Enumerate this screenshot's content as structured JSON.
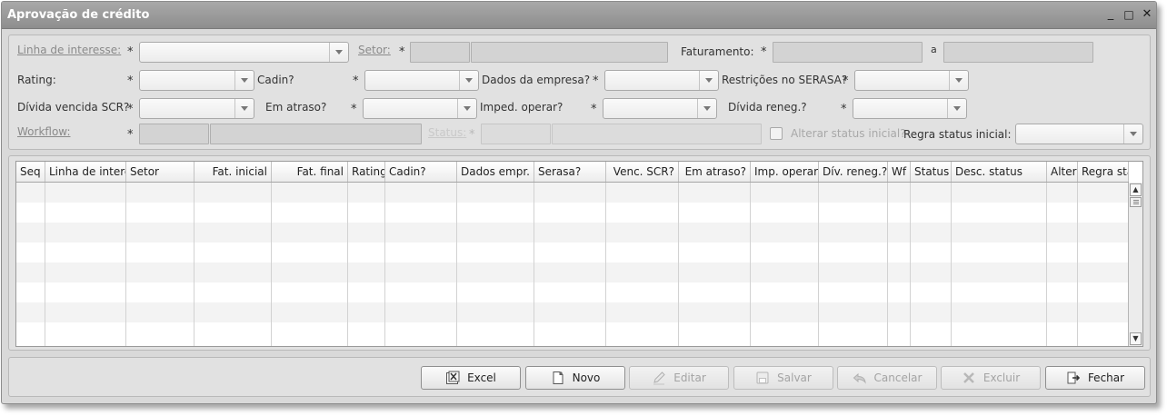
{
  "window": {
    "title": "Aprovação de crédito",
    "controls": {
      "minimize": "_",
      "maximize": "□",
      "close": "✕"
    }
  },
  "filters": {
    "required_mark": "*",
    "linha_interesse": {
      "label": "Linha de interesse:",
      "value": ""
    },
    "setor": {
      "label": "Setor:",
      "code": "",
      "description": ""
    },
    "faturamento": {
      "label": "Faturamento:",
      "from": "",
      "range_sep": "a",
      "to": ""
    },
    "rating": {
      "label": "Rating:",
      "value": ""
    },
    "cadin": {
      "label": "Cadin?",
      "value": ""
    },
    "dados_empresa": {
      "label": "Dados da empresa?",
      "value": ""
    },
    "restricoes_serasa": {
      "label": "Restrições no SERASA?",
      "value": ""
    },
    "divida_vencida_scr": {
      "label": "Dívida vencida SCR?",
      "value": ""
    },
    "em_atraso": {
      "label": "Em atraso?",
      "value": ""
    },
    "imped_operar": {
      "label": "Imped. operar?",
      "value": ""
    },
    "divida_reneg": {
      "label": "Dívida reneg.?",
      "value": ""
    },
    "workflow": {
      "label": "Workflow:",
      "code": "",
      "description": ""
    },
    "status": {
      "label": "Status:",
      "code": "",
      "description": ""
    },
    "alterar_status_inicial": {
      "label": "Alterar status inicial?",
      "checked": false
    },
    "regra_status_inicial": {
      "label": "Regra status inicial:",
      "value": ""
    }
  },
  "grid": {
    "columns": [
      "Seq",
      "Linha de interesse",
      "Setor",
      "Fat. inicial",
      "Fat. final",
      "Rating",
      "Cadin?",
      "Dados empr.",
      "Serasa?",
      "Venc. SCR?",
      "Em atraso?",
      "Imp. operar",
      "Dív. reneg.?",
      "Wf",
      "Status",
      "Desc. status",
      "Alterar",
      "Regra status"
    ],
    "rows": []
  },
  "buttons": {
    "excel": "Excel",
    "novo": "Novo",
    "editar": "Editar",
    "salvar": "Salvar",
    "cancelar": "Cancelar",
    "excluir": "Excluir",
    "fechar": "Fechar"
  },
  "icons": {
    "excel": "excel-icon",
    "novo": "new-document-icon",
    "editar": "pencil-icon",
    "salvar": "save-icon",
    "cancelar": "undo-icon",
    "excluir": "delete-x-icon",
    "fechar": "exit-door-icon"
  }
}
